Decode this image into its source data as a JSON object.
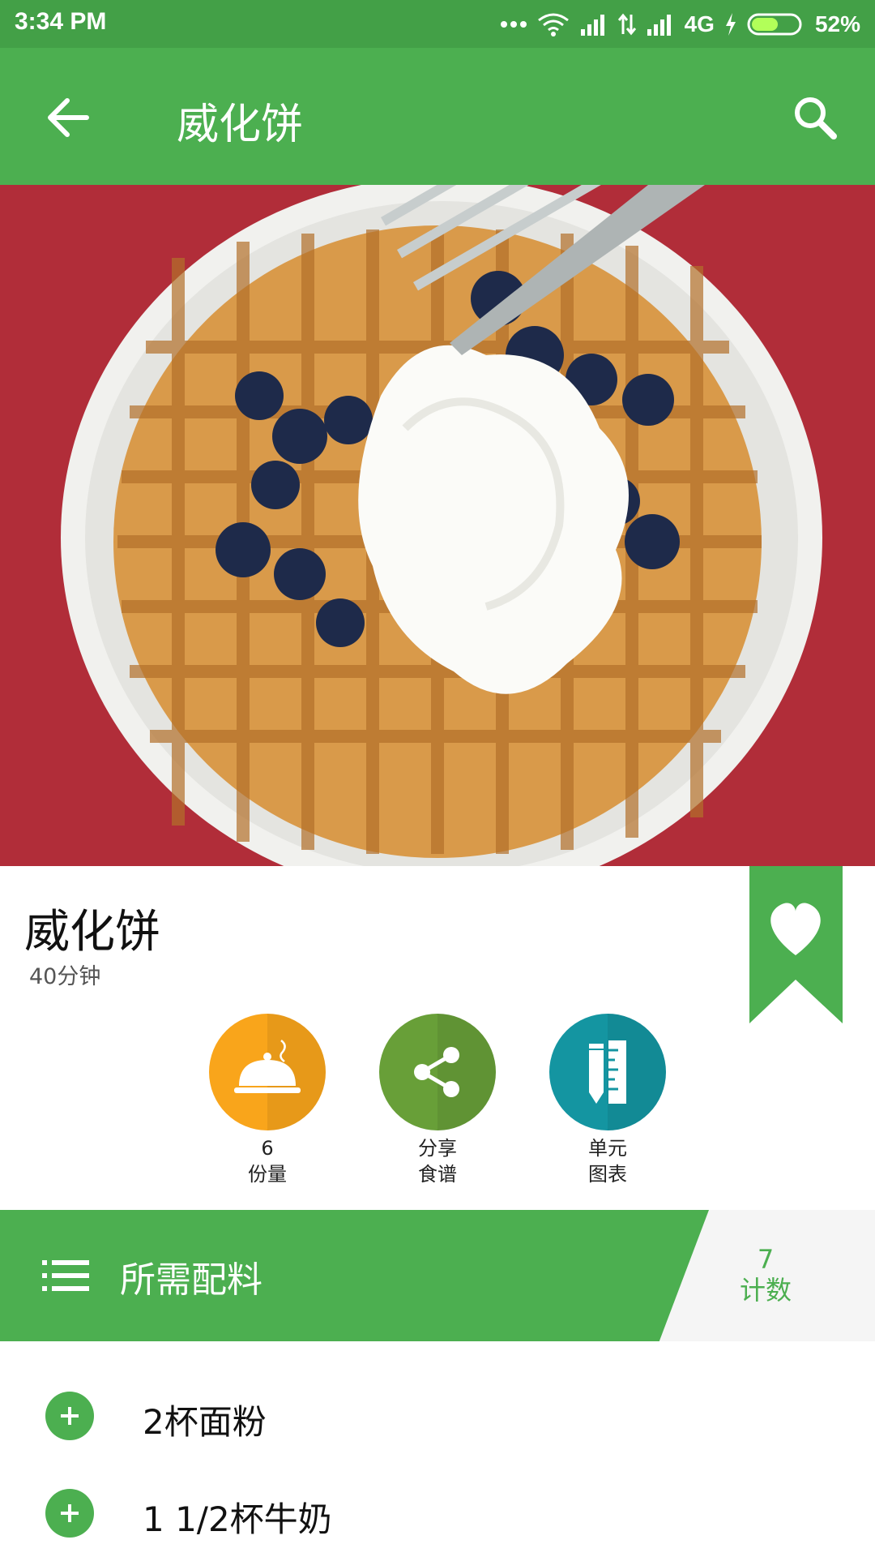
{
  "status_bar": {
    "time": "3:34 PM",
    "network": "4G",
    "battery": "52%"
  },
  "app_bar": {
    "title": "威化饼",
    "back_icon": "arrow-left-icon",
    "search_icon": "search-icon"
  },
  "recipe": {
    "title": "威化饼",
    "time": "40分钟",
    "bookmark_icon": "heart-icon"
  },
  "actions": [
    {
      "value": "6",
      "label": "份量",
      "icon": "cloche-icon",
      "color": "#f9a51b"
    },
    {
      "line1": "分享",
      "line2": "食谱",
      "icon": "share-icon",
      "color": "#689f38"
    },
    {
      "line1": "单元",
      "line2": "图表",
      "icon": "ruler-pencil-icon",
      "color": "#1495a1"
    }
  ],
  "ingredients": {
    "header": "所需配料",
    "count": "7",
    "count_label": "计数",
    "items": [
      {
        "text": "2杯面粉"
      },
      {
        "text": "1 1/2杯牛奶"
      }
    ]
  },
  "colors": {
    "primary": "#4caf50",
    "status_bar": "#43a047"
  }
}
